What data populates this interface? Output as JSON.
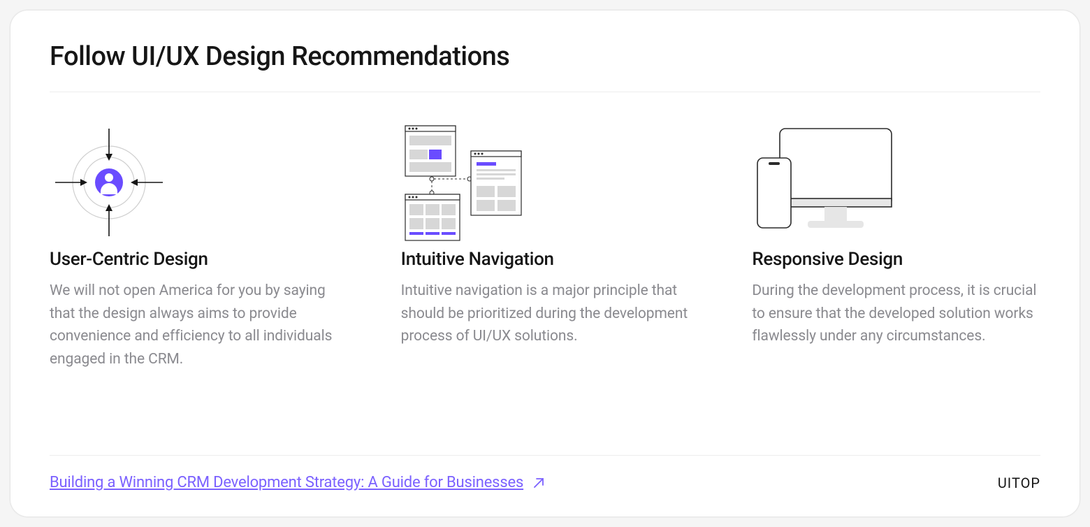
{
  "title": "Follow UI/UX Design Recommendations",
  "columns": [
    {
      "title": "User-Centric Design",
      "body": "We will not open America for you by saying that the design always aims to provide convenience and efficiency to all individuals engaged in the CRM."
    },
    {
      "title": "Intuitive Navigation",
      "body": "Intuitive navigation is a major principle that should be prioritized during the development process of UI/UX solutions."
    },
    {
      "title": "Responsive Design",
      "body": "During the development process, it is crucial to ensure that the developed solution works flawlessly under any circumstances."
    }
  ],
  "footer": {
    "link_label": "Building a Winning CRM Development Strategy: A Guide for Businesses",
    "brand": "UITOP"
  },
  "colors": {
    "accent": "#7b61ff",
    "text": "#161616",
    "muted": "#8a8a8f",
    "border": "#ededed"
  }
}
